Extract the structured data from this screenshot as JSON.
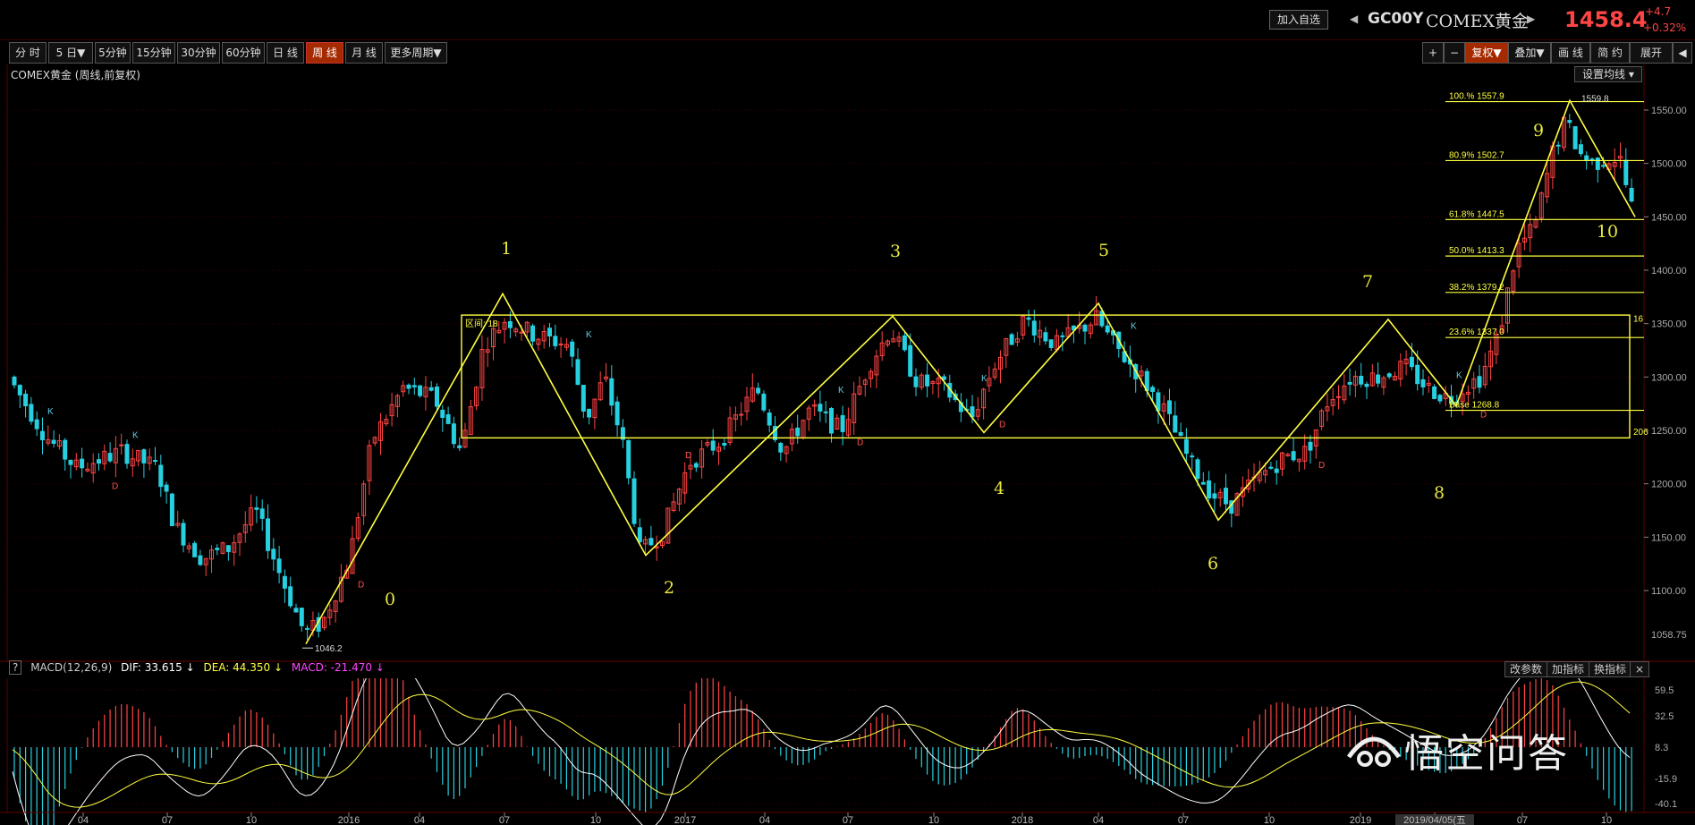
{
  "header": {
    "add_watch": "加入自选",
    "symbol_code": "GC00Y",
    "symbol_name": "COMEX黄金",
    "price": "1458.4",
    "change": "+4.7",
    "change_pct": "+0.32%"
  },
  "toolbar": {
    "periods": [
      "分 时",
      "5 日▼",
      "5分钟",
      "15分钟",
      "30分钟",
      "60分钟",
      "日 线",
      "周 线",
      "月 线",
      "更多周期▼"
    ],
    "active_period": "周 线",
    "right_buttons": [
      "+",
      "−",
      "复权▼",
      "叠加▼",
      "画 线",
      "简 约",
      "展开"
    ],
    "active_right": "复权▼"
  },
  "chart": {
    "title": "COMEX黄金 (周线,前复权)",
    "set_ma": "设置均线",
    "yaxis_labels": [
      "1550.00",
      "1500.00",
      "1450.00",
      "1400.00",
      "1350.00",
      "1300.00",
      "1250.00",
      "1200.00",
      "1150.00",
      "1100.00",
      "1058.75"
    ],
    "xaxis_labels": [
      "04",
      "07",
      "10",
      "2016",
      "04",
      "07",
      "10",
      "2017",
      "04",
      "07",
      "10",
      "2018",
      "04",
      "07",
      "10",
      "2019",
      "2019/04/05(五",
      "07",
      "10"
    ],
    "wave_labels": [
      "0",
      "1",
      "2",
      "3",
      "4",
      "5",
      "6",
      "7",
      "8",
      "9",
      "10"
    ],
    "fib_levels": [
      "100.% 1557.9",
      "80.9% 1502.7",
      "61.8% 1447.5",
      "50.0% 1413.3",
      "38.2% 1379.2",
      "23.6% 1337.0",
      "Base 1268.8"
    ],
    "annotations": {
      "low": "1046.2",
      "high": "1559.8",
      "box_label": "区间",
      "box_right_top": "16",
      "box_right_bottom": "206",
      "k_marker": "K",
      "d_marker": "D"
    }
  },
  "macd": {
    "help": "?",
    "name": "MACD(12,26,9)",
    "dif": "DIF: 33.615 ↓",
    "dea": "DEA: 44.350 ↓",
    "macd": "MACD: -21.470 ↓",
    "buttons": [
      "改参数",
      "加指标",
      "换指标"
    ],
    "close": "×",
    "yaxis_labels": [
      "59.5",
      "32.5",
      "8.3",
      "-15.9",
      "-40.1"
    ]
  },
  "watermark": "悟空问答",
  "colors": {
    "up": "#ff4444",
    "down": "#27d0e0",
    "wave": "#ffff40",
    "fib": "#ffff40",
    "grid": "#3a0000",
    "dif": "#ffffff",
    "dea": "#ffff40"
  }
}
